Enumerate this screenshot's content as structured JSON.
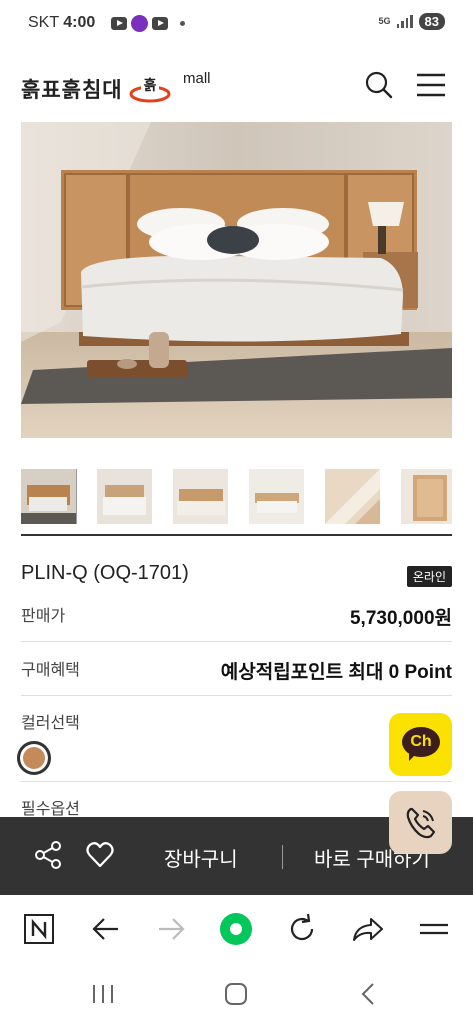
{
  "status_bar": {
    "carrier": "SKT",
    "time": "4:00",
    "twitch_label": "twitch",
    "network": "5G",
    "battery": "83"
  },
  "header": {
    "logo_text": "흙표흙침대",
    "logo_mall": "mall",
    "search_icon": "search-icon",
    "menu_icon": "hamburger-menu-icon"
  },
  "product": {
    "name": "PLIN-Q (OQ-1701)",
    "badge": "온라인",
    "price_label": "판매가",
    "price_value": "5,730,000원",
    "benefit_label": "구매혜택",
    "benefit_value": "예상적립포인트 최대 0 Point",
    "color_label": "컬러선택",
    "color_selected": "#c48a5a",
    "option_label": "필수옵션",
    "thumbnail_count": 6,
    "active_thumbnail": 1
  },
  "floating": {
    "kakao_label": "Ch",
    "kakao_color": "#fae100",
    "call_icon": "phone-call-icon"
  },
  "action_bar": {
    "share_icon": "share-icon",
    "wishlist_icon": "heart-icon",
    "cart_label": "장바구니",
    "buy_label": "바로 구매하기"
  },
  "browser_bar": {
    "items": [
      "naver-home-icon",
      "back-arrow-icon",
      "forward-arrow-icon",
      "green-dot-icon",
      "refresh-icon",
      "share-arrow-icon",
      "menu-icon"
    ],
    "accent": "#03c75a"
  },
  "system_nav": [
    "recent-apps-icon",
    "home-icon",
    "back-icon"
  ]
}
